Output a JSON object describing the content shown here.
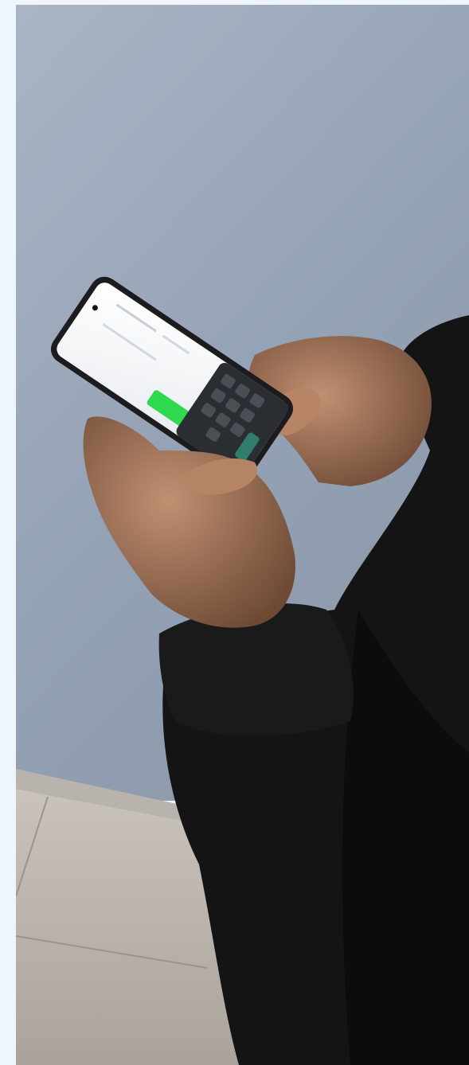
{
  "image": {
    "subject": "photo",
    "colors": {
      "page_background": "#eef5fd",
      "wall": "#9aa7b8",
      "floor": "#b9b2a9",
      "jacket": "#141414",
      "skin": "#b07f60",
      "phone_body": "#1c1c1e",
      "screen": "#f4f6f8",
      "button_green": "#2ed94f",
      "keyboard": "#2a2d32"
    }
  }
}
